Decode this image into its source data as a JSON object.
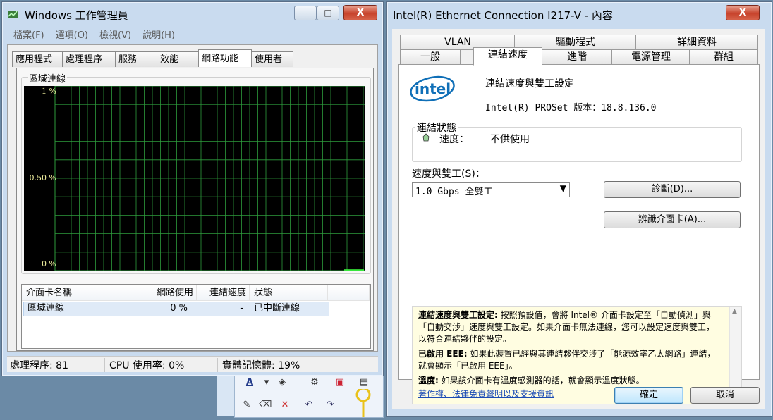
{
  "task_manager": {
    "title": "Windows 工作管理員",
    "menu": [
      "檔案(F)",
      "選項(O)",
      "檢視(V)",
      "說明(H)"
    ],
    "tabs": [
      "應用程式",
      "處理程序",
      "服務",
      "效能",
      "網路功能",
      "使用者"
    ],
    "active_tab": "網路功能",
    "group_label": "區域連線",
    "graph": {
      "y_labels": [
        "1 %",
        "0.50 %",
        "0 %"
      ],
      "value_percent": 0,
      "grid_color": "#2e9c3c",
      "line_color": "#3cff3c"
    },
    "table": {
      "columns": [
        "介面卡名稱",
        "網路使用",
        "連結速度",
        "狀態"
      ],
      "rows": [
        {
          "name": "區域連線",
          "usage": "0 %",
          "speed": "-",
          "status": "已中斷連線"
        }
      ]
    },
    "status": {
      "processes": "處理程序: 81",
      "cpu": "CPU 使用率: 0%",
      "memory": "實體記憶體: 19%"
    }
  },
  "properties": {
    "title": "Intel(R) Ethernet Connection I217-V - 內容",
    "tabs_row1": [
      "VLAN",
      "驅動程式",
      "詳細資料"
    ],
    "tabs_row2": [
      "一般",
      "連結速度",
      "進階",
      "電源管理",
      "群組"
    ],
    "active_tab": "連結速度",
    "logo_text": "intel",
    "heading": "連結速度與雙工設定",
    "version": "Intel(R) PROSet 版本：18.8.136.0",
    "link_status_label": "連結狀態",
    "speed_label": "速度：",
    "speed_value": "不供使用",
    "duplex_label": "速度與雙工(S)：",
    "duplex_value": "1.0 Gbps 全雙工",
    "diagnose_button": "診斷(D)...",
    "identify_button": "辨識介面卡(A)...",
    "info": {
      "p1_bold": "連結速度與雙工設定:",
      "p1_text": " 按照預設值，會將 Intel® 介面卡設定至「自動偵測」與「自動交涉」速度與雙工設定。如果介面卡無法連線，您可以設定速度與雙工，以符合連結夥伴的設定。",
      "p2_bold": "已啟用 EEE:",
      "p2_text": " 如果此裝置已經與其連結夥伴交涉了「能源效率乙太網路」連結，就會顯示「已啟用 EEE」。",
      "p3_bold": "溫度:",
      "p3_text": " 如果該介面卡有溫度感測器的話，就會顯示溫度狀態。",
      "link": "著作權、法律免責聲明以及支援資訊"
    },
    "ok_button": "確定",
    "cancel_button": "取消",
    "close_glyph": "X"
  },
  "window_controls": {
    "minimize": "—",
    "maximize": "□",
    "close": "X"
  }
}
